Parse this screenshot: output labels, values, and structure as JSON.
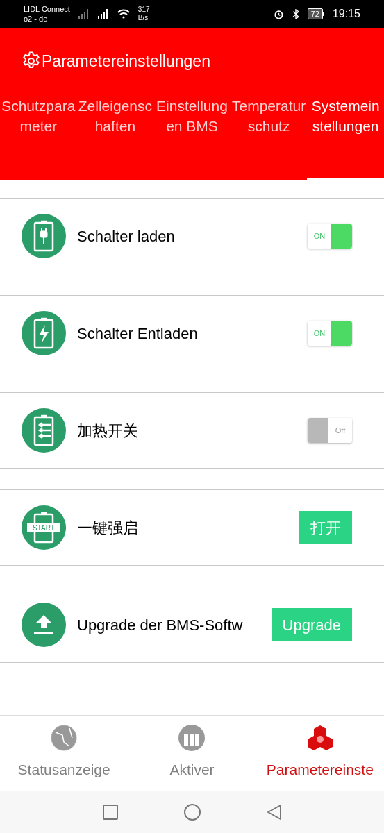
{
  "status_bar": {
    "carrier": "LIDL Connect",
    "network": "o2 - de",
    "speed": "317",
    "speed_unit": "B/s",
    "battery": "72",
    "time": "19:15"
  },
  "header": {
    "title": "Parametereinstellungen"
  },
  "tabs": [
    {
      "label": "Schutzparameter",
      "selected": false
    },
    {
      "label": "Zelleigenschaften",
      "selected": false
    },
    {
      "label": "Einstellungen BMS",
      "selected": false
    },
    {
      "label": "Temperaturschutz",
      "selected": false
    },
    {
      "label": "Systemeinstellungen",
      "selected": true
    }
  ],
  "settings": [
    {
      "kind": "toggle",
      "label": "Schalter laden",
      "on": true,
      "switch_text": "ON"
    },
    {
      "kind": "toggle",
      "label": "Schalter Entladen",
      "on": true,
      "switch_text": "ON"
    },
    {
      "kind": "toggle",
      "label": "加热开关",
      "on": false,
      "switch_text": "Off"
    },
    {
      "kind": "button",
      "label": "一键强启",
      "icon_text": "START",
      "button": "打开"
    },
    {
      "kind": "button",
      "label": "Upgrade der BMS-Softw",
      "button": "Upgrade"
    }
  ],
  "bottom_nav": [
    {
      "label": "Statusanzeige",
      "selected": false
    },
    {
      "label": "Aktiver",
      "selected": false
    },
    {
      "label": "Parametereinste",
      "selected": true
    }
  ]
}
